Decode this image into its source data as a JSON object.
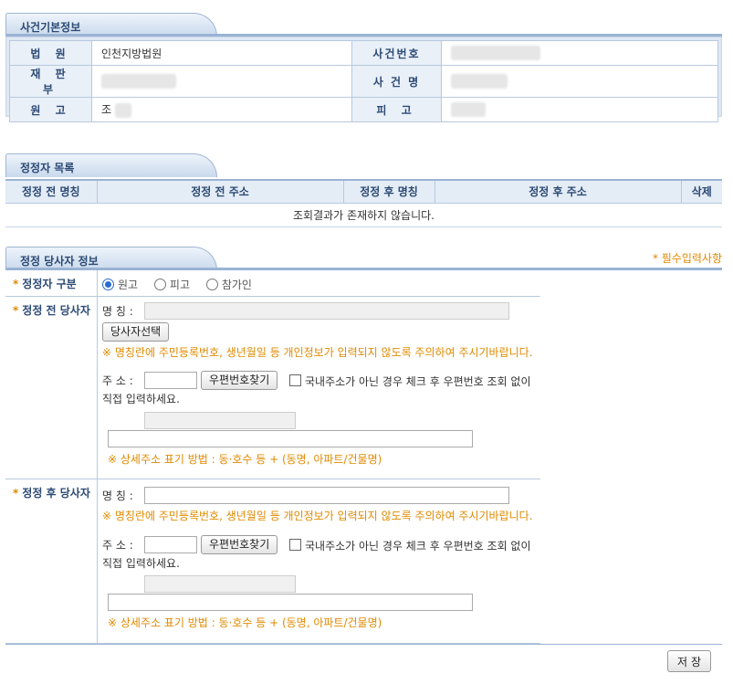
{
  "case_info": {
    "section_title": "사건기본정보",
    "court_label": "법 원",
    "court_value": "인천지방법원",
    "case_no_label": "사건번호",
    "division_label": "재 판 부",
    "case_name_label": "사 건 명",
    "plaintiff_label": "원 고",
    "plaintiff_value": "조",
    "defendant_label": "피 고"
  },
  "corrector_list": {
    "section_title": "정정자 목록",
    "columns": [
      "정정 전 명칭",
      "정정 전 주소",
      "정정 후 명칭",
      "정정 후 주소",
      "삭제"
    ],
    "empty_message": "조회결과가 존재하지 않습니다."
  },
  "party_info": {
    "section_title": "정정 당사자 정보",
    "required_note": "* 필수입력사항",
    "corrector_type_label": "정정자 구분",
    "radio_options": [
      {
        "label": "원고",
        "selected": true
      },
      {
        "label": "피고",
        "selected": false
      },
      {
        "label": "참가인",
        "selected": false
      }
    ],
    "before_party_label": "정정 전 당사자",
    "after_party_label": "정정 후 당사자",
    "name_label": "명 칭 :",
    "select_party_button": "당사자선택",
    "name_warning": "※ 명칭란에 주민등록번호, 생년월일 등 개인정보가 입력되지 않도록 주의하여 주시기바랍니다.",
    "address_label": "주 소 :",
    "postcode_button": "우편번호찾기",
    "foreign_address_note": "국내주소가 아닌 경우 체크 후 우편번호 조회 없이 직접 입력하세요.",
    "detail_address_hint": "※ 상세주소 표기 방법 : 동·호수 등 + (동명, 아파트/건물명)"
  },
  "save_button": "저장",
  "colors": {
    "header_text": "#2c4a74",
    "accent_orange": "#e08a00",
    "border": "#b7c9df"
  }
}
